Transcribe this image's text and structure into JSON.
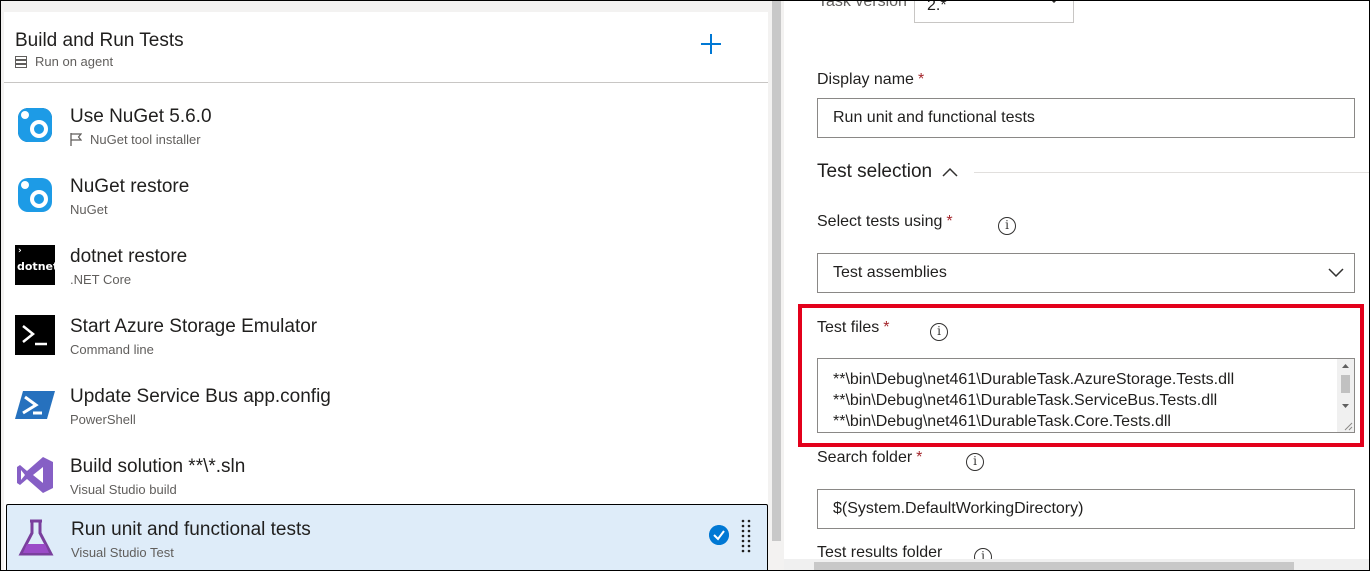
{
  "phase": {
    "title": "Build and Run Tests",
    "subtitle": "Run on agent"
  },
  "tasks": [
    {
      "name": "Use NuGet 5.6.0",
      "subtitle": "NuGet tool installer",
      "icon": "nuget-icon",
      "sub_icon": "flag-icon"
    },
    {
      "name": "NuGet restore",
      "subtitle": "NuGet",
      "icon": "nuget-icon"
    },
    {
      "name": "dotnet restore",
      "subtitle": ".NET Core",
      "icon": "dotnet-icon",
      "icon_text": "dotnet"
    },
    {
      "name": "Start Azure Storage Emulator",
      "subtitle": "Command line",
      "icon": "command-line-icon"
    },
    {
      "name": "Update Service Bus app.config",
      "subtitle": "PowerShell",
      "icon": "powershell-icon"
    },
    {
      "name": "Build solution **\\*.sln",
      "subtitle": "Visual Studio build",
      "icon": "visual-studio-icon"
    },
    {
      "name": "Run unit and functional tests",
      "subtitle": "Visual Studio Test",
      "icon": "flask-icon",
      "selected": true
    }
  ],
  "details": {
    "task_version_label": "Task version",
    "task_version_value": "2.*",
    "display_name_label": "Display name",
    "display_name_value": "Run unit and functional tests",
    "section_title": "Test selection",
    "select_tests_label": "Select tests using",
    "select_tests_value": "Test assemblies",
    "test_files_label": "Test files",
    "test_files_lines": [
      "**\\bin\\Debug\\net461\\DurableTask.AzureStorage.Tests.dll",
      "**\\bin\\Debug\\net461\\DurableTask.ServiceBus.Tests.dll",
      "**\\bin\\Debug\\net461\\DurableTask.Core.Tests.dll"
    ],
    "search_folder_label": "Search folder",
    "search_folder_value": "$(System.DefaultWorkingDirectory)",
    "test_results_label": "Test results folder",
    "required_mark": "*",
    "info_glyph": "i"
  },
  "colors": {
    "accent": "#0078d4",
    "highlight": "#e3001b",
    "selected_bg": "#deecf9",
    "required": "#a4262c"
  }
}
